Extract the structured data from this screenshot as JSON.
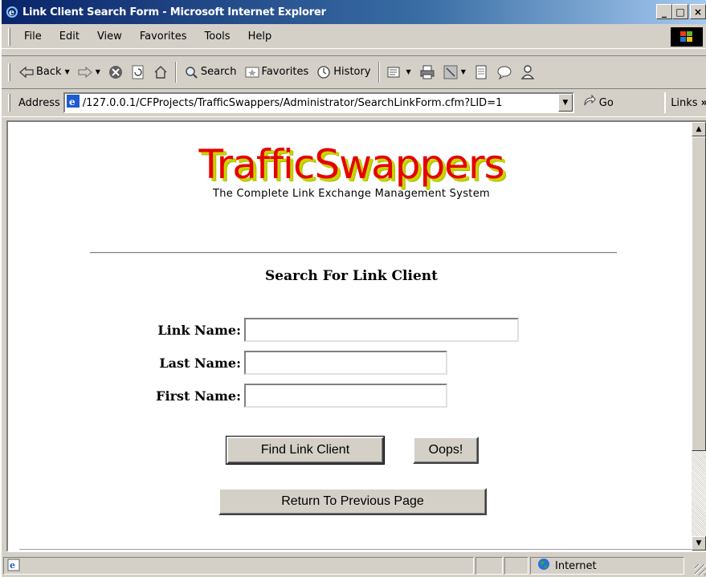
{
  "window": {
    "title": "Link Client Search Form - Microsoft Internet Explorer",
    "controls": {
      "minimize": "_",
      "maximize": "□",
      "close": "×"
    }
  },
  "menu": {
    "items": [
      {
        "label": "File"
      },
      {
        "label": "Edit"
      },
      {
        "label": "View"
      },
      {
        "label": "Favorites"
      },
      {
        "label": "Tools"
      },
      {
        "label": "Help"
      }
    ]
  },
  "toolbar": {
    "back": "Back",
    "search": "Search",
    "favorites": "Favorites",
    "history": "History"
  },
  "address": {
    "label": "Address",
    "url": "/127.0.0.1/CFProjects/TrafficSwappers/Administrator/SearchLinkForm.cfm?LID=1",
    "go": "Go",
    "links": "Links"
  },
  "page": {
    "brand_title": "TrafficSwappers",
    "brand_subtitle": "The Complete Link Exchange Management System",
    "heading": "Search For Link Client",
    "fields": {
      "link_name": {
        "label": "Link Name:",
        "value": ""
      },
      "last_name": {
        "label": "Last Name:",
        "value": ""
      },
      "first_name": {
        "label": "First Name:",
        "value": ""
      }
    },
    "buttons": {
      "find": "Find Link Client",
      "oops": "Oops!",
      "return": "Return To Previous Page"
    }
  },
  "status": {
    "zone": "Internet"
  },
  "colors": {
    "titlebar": "#0a246a",
    "brand_red": "#e60000",
    "brand_shadow": "#c9d400",
    "chrome": "#d4d0c8"
  }
}
